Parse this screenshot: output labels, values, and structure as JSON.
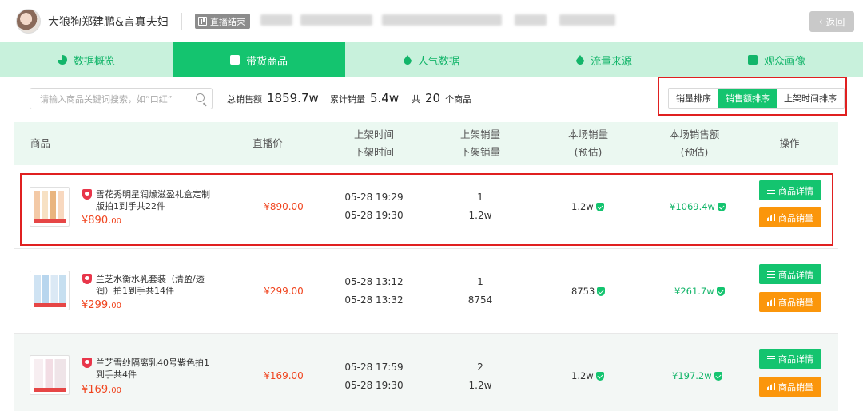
{
  "header": {
    "streamer_name": "大狼狗郑建鹏&言真夫妇",
    "live_status": "直播结束",
    "back_label": "返回"
  },
  "tabs": [
    {
      "label": "数据概览",
      "icon": "pie-chart-icon",
      "active": false
    },
    {
      "label": "带货商品",
      "icon": "shopping-bag-icon",
      "active": true
    },
    {
      "label": "人气数据",
      "icon": "drop-icon",
      "active": false
    },
    {
      "label": "流量来源",
      "icon": "drop-icon",
      "active": false
    },
    {
      "label": "观众画像",
      "icon": "user-card-icon",
      "active": false
    }
  ],
  "toolbar": {
    "search_placeholder": "请输入商品关键词搜索，如“口红”",
    "total_sales_label": "总销售额",
    "total_sales_value": "1859.7w",
    "total_volume_label": "累计销量",
    "total_volume_value": "5.4w",
    "count_prefix": "共",
    "count_value": "20",
    "count_suffix": "个商品",
    "sort_options": [
      {
        "label": "销量排序",
        "active": false
      },
      {
        "label": "销售额排序",
        "active": true
      },
      {
        "label": "上架时间排序",
        "active": false
      }
    ]
  },
  "table": {
    "headers": {
      "product": "商品",
      "live_price": "直播价",
      "list_time_1": "上架时间",
      "list_time_2": "下架时间",
      "list_volume_1": "上架销量",
      "list_volume_2": "下架销量",
      "est_volume_1": "本场销量",
      "est_volume_2": "(预估)",
      "est_sales_1": "本场销售额",
      "est_sales_2": "(预估)",
      "actions": "操作"
    },
    "rows": [
      {
        "name": "雪花秀明星润燥滋盈礼盒定制版拍1到手共22件",
        "price_int": "¥890.",
        "price_dec": "00",
        "live_price": "¥890.00",
        "on_time": "05-28 19:29",
        "off_time": "05-28 19:30",
        "on_volume": "1",
        "off_volume": "1.2w",
        "est_volume": "1.2w",
        "est_sales": "¥1069.4w",
        "detail_label": "商品详情",
        "sales_label": "商品销量"
      },
      {
        "name": "兰芝水衡水乳套装（清盈/透润）拍1到手共14件",
        "price_int": "¥299.",
        "price_dec": "00",
        "live_price": "¥299.00",
        "on_time": "05-28 13:12",
        "off_time": "05-28 13:32",
        "on_volume": "1",
        "off_volume": "8754",
        "est_volume": "8753",
        "est_sales": "¥261.7w",
        "detail_label": "商品详情",
        "sales_label": "商品销量"
      },
      {
        "name": "兰芝雪纱隔离乳40号紫色拍1到手共4件",
        "price_int": "¥169.",
        "price_dec": "00",
        "live_price": "¥169.00",
        "on_time": "05-28 17:59",
        "off_time": "05-28 19:30",
        "on_volume": "2",
        "off_volume": "1.2w",
        "est_volume": "1.2w",
        "est_sales": "¥197.2w",
        "detail_label": "商品详情",
        "sales_label": "商品销量"
      }
    ]
  },
  "colors": {
    "accent_green": "#14c46f",
    "tab_bg": "#c8f1dc",
    "price_red": "#f0441e",
    "highlight_red": "#e02020",
    "button_orange": "#fb960b"
  }
}
